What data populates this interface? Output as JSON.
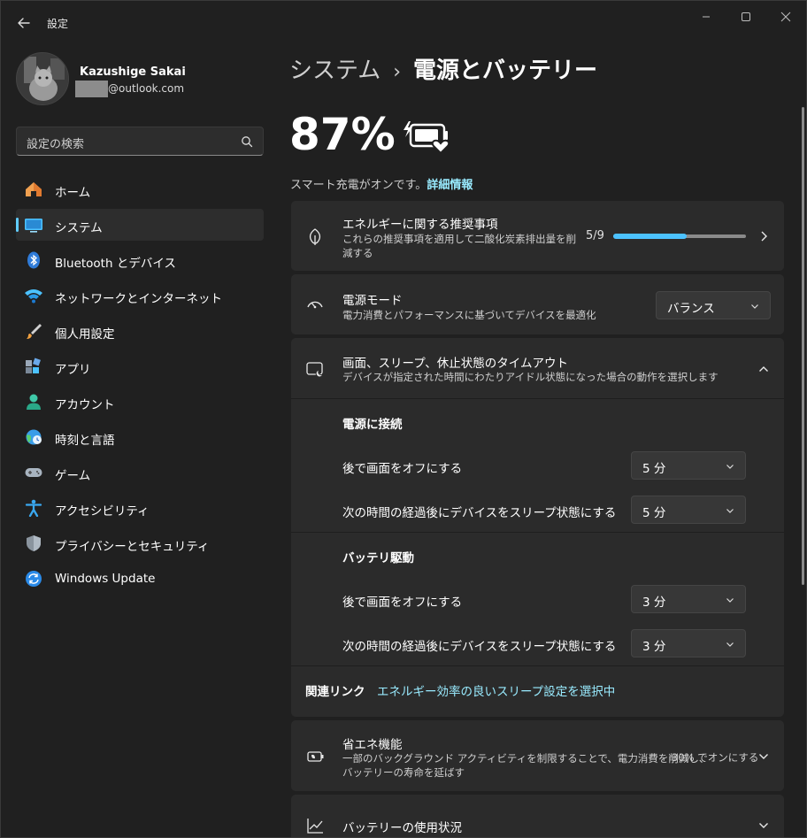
{
  "window": {
    "app_title": "設定"
  },
  "profile": {
    "name": "Kazushige Sakai",
    "email_visible": "@outlook.com"
  },
  "search": {
    "placeholder": "設定の検索"
  },
  "nav": {
    "items": [
      {
        "label": "ホーム",
        "icon": "home-icon"
      },
      {
        "label": "システム",
        "icon": "system-icon",
        "active": true
      },
      {
        "label": "Bluetooth とデバイス",
        "icon": "bluetooth-icon"
      },
      {
        "label": "ネットワークとインターネット",
        "icon": "wifi-icon"
      },
      {
        "label": "個人用設定",
        "icon": "brush-icon"
      },
      {
        "label": "アプリ",
        "icon": "apps-icon"
      },
      {
        "label": "アカウント",
        "icon": "account-icon"
      },
      {
        "label": "時刻と言語",
        "icon": "globe-clock-icon"
      },
      {
        "label": "ゲーム",
        "icon": "gamepad-icon"
      },
      {
        "label": "アクセシビリティ",
        "icon": "accessibility-icon"
      },
      {
        "label": "プライバシーとセキュリティ",
        "icon": "shield-icon"
      },
      {
        "label": "Windows Update",
        "icon": "update-icon"
      }
    ]
  },
  "breadcrumb": {
    "parent": "システム",
    "separator": "›",
    "current": "電源とバッテリー"
  },
  "battery": {
    "percent": "87%",
    "smart_charge_text": "スマート充電がオンです。",
    "smart_charge_link": "詳細情報"
  },
  "energy": {
    "title": "エネルギーに関する推奨事項",
    "desc": "これらの推奨事項を適用して二酸化炭素排出量を削減する",
    "progress_text": "5/9",
    "progress_fraction": 0.556
  },
  "power_mode": {
    "title": "電源モード",
    "desc": "電力消費とパフォーマンスに基づいてデバイスを最適化",
    "value": "バランス"
  },
  "screen_sleep": {
    "title": "画面、スリープ、休止状態のタイムアウト",
    "desc": "デバイスが指定された時間にわたりアイドル状態になった場合の動作を選択します",
    "plugged_in": {
      "heading": "電源に接続",
      "screen_off_label": "後で画面をオフにする",
      "screen_off_value": "5 分",
      "sleep_label": "次の時間の経過後にデバイスをスリープ状態にする",
      "sleep_value": "5 分"
    },
    "on_battery": {
      "heading": "バッテリ駆動",
      "screen_off_label": "後で画面をオフにする",
      "screen_off_value": "3 分",
      "sleep_label": "次の時間の経過後にデバイスをスリープ状態にする",
      "sleep_value": "3 分"
    },
    "related_label": "関連リンク",
    "related_link": "エネルギー効率の良いスリープ設定を選択中"
  },
  "energy_saver": {
    "title": "省エネ機能",
    "desc_line1": "一部のバックグラウンド アクティビティを制限することで、電力消費を削減し、",
    "desc_line2": "バッテリーの寿命を延ばす",
    "status": "30% でオンにする"
  },
  "battery_usage": {
    "title": "バッテリーの使用状況"
  },
  "colors": {
    "accent": "#60cdff",
    "link": "#99ebff",
    "background": "#202020",
    "card": "#2b2b2b"
  }
}
